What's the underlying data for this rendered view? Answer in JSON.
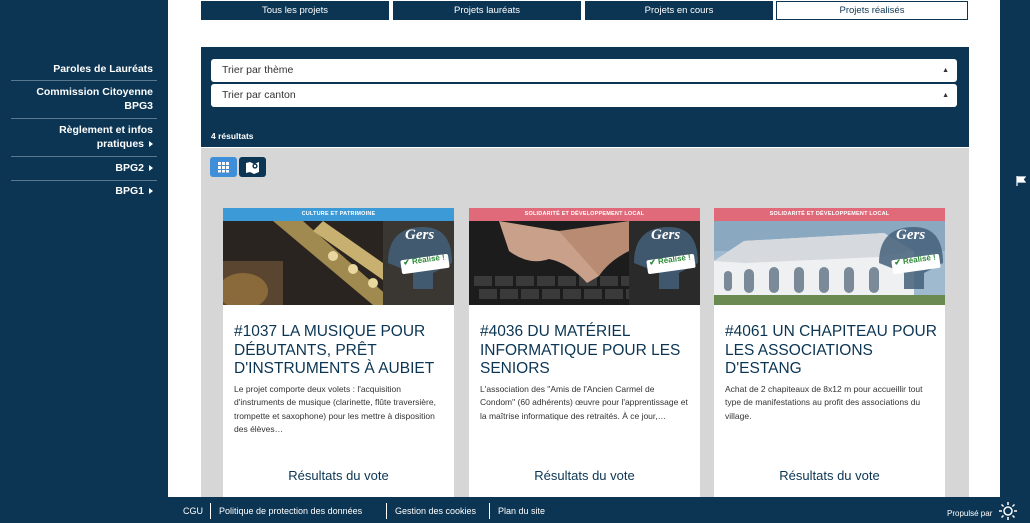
{
  "sidebar": {
    "items": [
      {
        "label": "Paroles de Lauréats"
      },
      {
        "label": "Commission Citoyenne",
        "label2": "BPG3"
      },
      {
        "label": "Règlement et infos",
        "label2": "pratiques"
      },
      {
        "label": "BPG2"
      },
      {
        "label": "BPG1"
      }
    ]
  },
  "tabs": [
    {
      "label": "Tous les projets"
    },
    {
      "label": "Projets lauréats"
    },
    {
      "label": "Projets en cours"
    },
    {
      "label": "Projets réalisés"
    }
  ],
  "filters": {
    "theme": "Trier par thème",
    "canton": "Trier par canton",
    "results": "4 résultats"
  },
  "colors": {
    "navy": "#0b3553",
    "culture": "#3c9ad6",
    "solidarite": "#e06a7a",
    "grid_active": "#3e8ed8"
  },
  "cards": [
    {
      "category": "CULTURE ET PATRIMOINE",
      "category_color": "#3c9ad6",
      "badge_logo": "Gers",
      "badge_text": "Réalisé !",
      "image": "saxophone-photo",
      "title": "#1037 La musique pour débutants, prêt d'instruments à Aubiet",
      "description": "Le projet comporte deux volets : l'acquisition d'instruments de musique (clarinette, flûte traversière, trompette et saxophone) pour les mettre à disposition des élèves…",
      "vote": "Résultats du vote"
    },
    {
      "category": "SOLIDARITÉ ET DÉVELOPPEMENT LOCAL",
      "category_color": "#e06a7a",
      "badge_logo": "Gers",
      "badge_text": "Réalisé !",
      "image": "keyboard-photo",
      "title": "#4036 Du matériel informatique pour les seniors",
      "description": "L'association des \"Amis de l'Ancien Carmel de Condom\" (60 adhérents) œuvre pour l'apprentissage et la maîtrise informatique des retraités. À ce jour,…",
      "vote": "Résultats du vote"
    },
    {
      "category": "SOLIDARITÉ ET DÉVELOPPEMENT LOCAL",
      "category_color": "#e06a7a",
      "badge_logo": "Gers",
      "badge_text": "Réalisé !",
      "image": "tent-photo",
      "title": "#4061 Un chapiteau pour les associations d'Estang",
      "description": "Achat de 2 chapiteaux de 8x12 m pour accueillir tout type de manifestations au profit des associations du village.",
      "vote": "Résultats du vote"
    }
  ],
  "footer": {
    "links": [
      "CGU",
      "Politique de protection des données",
      "Gestion des cookies",
      "Plan du site"
    ],
    "powered": "Propulsé par"
  }
}
